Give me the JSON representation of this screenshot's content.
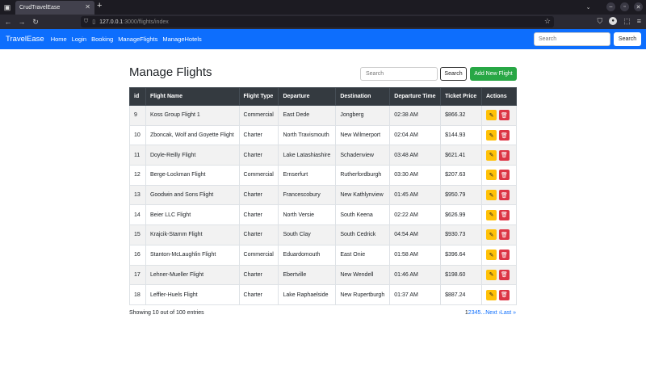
{
  "browser": {
    "tab_title": "CrudTravelEase",
    "url_host": "127.0.0.1",
    "url_path": ":3000/flights/index"
  },
  "nav": {
    "brand": "TravelEase",
    "links": [
      "Home",
      "Login",
      "Booking",
      "ManageFlights",
      "ManageHotels"
    ],
    "search_placeholder": "Search",
    "search_button": "Search"
  },
  "main": {
    "title": "Manage Flights",
    "search_placeholder": "Search",
    "search_button": "Search",
    "add_button": "Add New Flight",
    "columns": [
      "id",
      "Flight Name",
      "Flight Type",
      "Departure",
      "Destination",
      "Departure Time",
      "Ticket Price",
      "Actions"
    ],
    "rows": [
      [
        "9",
        "Koss Group Flight 1",
        "Commercial",
        "East Dede",
        "Jongberg",
        "02:38 AM",
        "$866.32"
      ],
      [
        "10",
        "Zboncak, Wolf and Goyette Flight",
        "Charter",
        "North Travismouth",
        "New Wilmerport",
        "02:04 AM",
        "$144.93"
      ],
      [
        "11",
        "Doyle-Reilly Flight",
        "Charter",
        "Lake Latashiashire",
        "Schadenview",
        "03:48 AM",
        "$621.41"
      ],
      [
        "12",
        "Berge-Lockman Flight",
        "Commercial",
        "Ernserfurt",
        "Rutherfordburgh",
        "03:30 AM",
        "$207.63"
      ],
      [
        "13",
        "Goodwin and Sons Flight",
        "Charter",
        "Francescobury",
        "New Kathlynview",
        "01:45 AM",
        "$950.79"
      ],
      [
        "14",
        "Beier LLC Flight",
        "Charter",
        "North Versie",
        "South Keena",
        "02:22 AM",
        "$626.99"
      ],
      [
        "15",
        "Krajcik-Stamm Flight",
        "Charter",
        "South Clay",
        "South Cedrick",
        "04:54 AM",
        "$930.73"
      ],
      [
        "16",
        "Stanton-McLaughlin Flight",
        "Commercial",
        "Eduardomouth",
        "East Onie",
        "01:58 AM",
        "$396.64"
      ],
      [
        "17",
        "Lehner-Mueller Flight",
        "Charter",
        "Ebertville",
        "New Wendell",
        "01:46 AM",
        "$198.60"
      ],
      [
        "18",
        "Leffler-Huels Flight",
        "Charter",
        "Lake Raphaelside",
        "New Rupertburgh",
        "01:37 AM",
        "$887.24"
      ]
    ],
    "showing_text": "Showing 10 out of 100 entries",
    "pagination": {
      "current": "1",
      "pages": [
        "2",
        "3",
        "4",
        "5"
      ],
      "ellipsis": "...",
      "next": "Next ›",
      "last": "Last »"
    }
  },
  "colors": {
    "nav_bg": "#0d6efd",
    "add_btn": "#28a745",
    "edit_btn": "#ffc107",
    "delete_btn": "#dc3545",
    "table_head": "#343a40"
  }
}
